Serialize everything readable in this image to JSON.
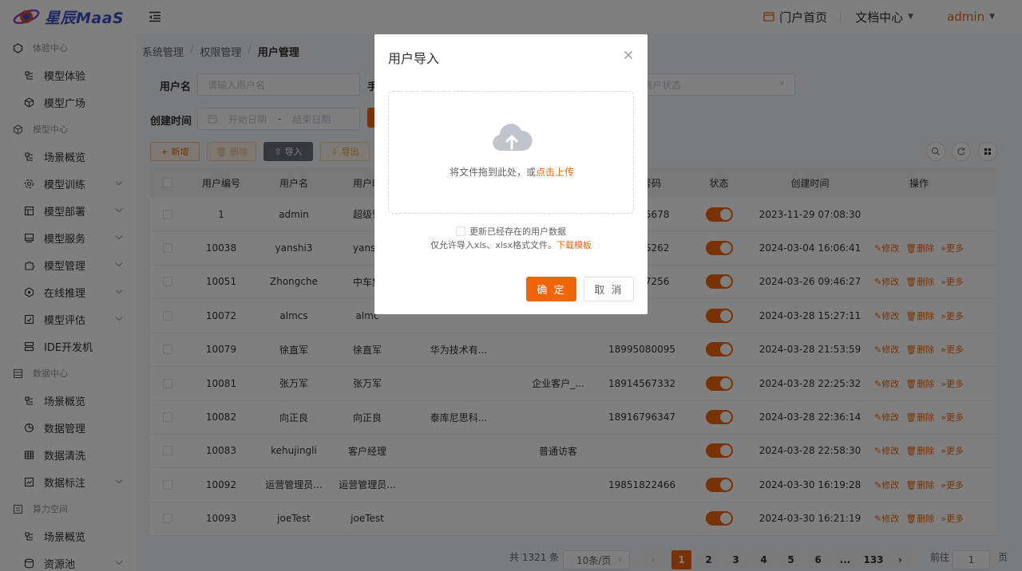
{
  "app": {
    "logo_text": "星辰MaaS"
  },
  "header": {
    "portal_link": "门户首页",
    "docs_link": "文档中心",
    "user": "admin"
  },
  "sidebar": {
    "groups": [
      {
        "label": "体验中心",
        "items": [
          {
            "label": "模型体验",
            "icon": "experience-icon"
          },
          {
            "label": "模型广场",
            "icon": "cube-icon"
          }
        ]
      },
      {
        "label": "模型中心",
        "items": [
          {
            "label": "场景概览",
            "icon": "overview-icon"
          },
          {
            "label": "模型训练",
            "icon": "train-icon",
            "expandable": true
          },
          {
            "label": "模型部署",
            "icon": "deploy-icon",
            "expandable": true
          },
          {
            "label": "模型服务",
            "icon": "service-icon",
            "expandable": true
          },
          {
            "label": "模型管理",
            "icon": "puzzle-icon",
            "expandable": true
          },
          {
            "label": "在线推理",
            "icon": "inference-icon",
            "expandable": true
          },
          {
            "label": "模型评估",
            "icon": "evaluate-icon",
            "expandable": true
          },
          {
            "label": "IDE开发机",
            "icon": "ide-icon"
          }
        ]
      },
      {
        "label": "数据中心",
        "items": [
          {
            "label": "场景概览",
            "icon": "overview-icon"
          },
          {
            "label": "数据管理",
            "icon": "pie-icon"
          },
          {
            "label": "数据清洗",
            "icon": "grid-icon"
          },
          {
            "label": "数据标注",
            "icon": "tag-icon",
            "expandable": true
          }
        ]
      },
      {
        "label": "算力空间",
        "items": [
          {
            "label": "场景概览",
            "icon": "overview-icon"
          },
          {
            "label": "资源池",
            "icon": "pool-icon",
            "expandable": true
          }
        ]
      }
    ]
  },
  "breadcrumb": [
    "系统管理",
    "权限管理",
    "用户管理"
  ],
  "filters": {
    "username_label": "用户名",
    "username_placeholder": "请输入用户名",
    "phone_label": "手",
    "status_placeholder": "用户状态",
    "created_label": "创建时间",
    "start_placeholder": "开始日期",
    "range_sep": "-",
    "end_placeholder": "结束日期"
  },
  "toolbar": {
    "add": "新增",
    "delete": "删除",
    "import": "导入",
    "export": "导出"
  },
  "table": {
    "columns": [
      "用户编号",
      "用户名",
      "用户昵",
      "手机号码",
      "状态",
      "创建时间",
      "操作"
    ],
    "op_labels": {
      "edit": "修改",
      "delete": "删除",
      "more": "更多"
    },
    "rows": [
      {
        "id": "1",
        "username": "admin",
        "nickname": "超级管",
        "dept": "",
        "role": "",
        "phone": "912345678",
        "created": "2023-11-29 07:08:30",
        "ops": false
      },
      {
        "id": "10038",
        "username": "yanshi3",
        "nickname": "yansh",
        "dept": "",
        "role": "",
        "phone": "986755262",
        "created": "2024-03-04 16:06:41",
        "ops": true
      },
      {
        "id": "10051",
        "username": "Zhongche",
        "nickname": "中车集",
        "dept": "",
        "role": "",
        "phone": "195897256",
        "created": "2024-03-26 09:46:27",
        "ops": true
      },
      {
        "id": "10072",
        "username": "almcs",
        "nickname": "almc",
        "dept": "",
        "role": "",
        "phone": "",
        "created": "2024-03-28 15:27:11",
        "ops": true
      },
      {
        "id": "10079",
        "username": "徐直军",
        "nickname": "徐直军",
        "dept": "华为技术有...",
        "role": "",
        "phone": "18995080095",
        "created": "2024-03-28 21:53:59",
        "ops": true
      },
      {
        "id": "10081",
        "username": "张万军",
        "nickname": "张万军",
        "dept": "",
        "role": "企业客户_...",
        "phone": "18914567332",
        "created": "2024-03-28 22:25:32",
        "ops": true
      },
      {
        "id": "10082",
        "username": "向正良",
        "nickname": "向正良",
        "dept": "泰库尼思科...",
        "role": "",
        "phone": "18916796347",
        "created": "2024-03-28 22:36:14",
        "ops": true
      },
      {
        "id": "10083",
        "username": "kehujingli",
        "nickname": "客户经理",
        "dept": "",
        "role": "普通访客",
        "phone": "",
        "created": "2024-03-28 22:58:30",
        "ops": true
      },
      {
        "id": "10092",
        "username": "运营管理员...",
        "nickname": "运营管理员...",
        "dept": "",
        "role": "",
        "phone": "19851822466",
        "created": "2024-03-30 16:19:28",
        "ops": true
      },
      {
        "id": "10093",
        "username": "joeTest",
        "nickname": "joeTest",
        "dept": "",
        "role": "",
        "phone": "",
        "created": "2024-03-30 16:21:19",
        "ops": true
      }
    ]
  },
  "pagination": {
    "total": "共 1321 条",
    "page_size": "10条/页",
    "pages": [
      "1",
      "2",
      "3",
      "4",
      "5",
      "6",
      "...",
      "133"
    ],
    "goto_label": "前往",
    "goto_value": "1",
    "page_unit": "页"
  },
  "dialog": {
    "title": "用户导入",
    "drop_text": "将文件拖到此处，或",
    "upload_link": "点击上传",
    "update_checkbox": "更新已经存在的用户数据",
    "tip": "仅允许导入xls、xlsx格式文件。",
    "template_link": "下载模板",
    "confirm": "确 定",
    "cancel": "取 消"
  },
  "colors": {
    "accent": "#f0650a",
    "brand": "#3b4ec8"
  }
}
